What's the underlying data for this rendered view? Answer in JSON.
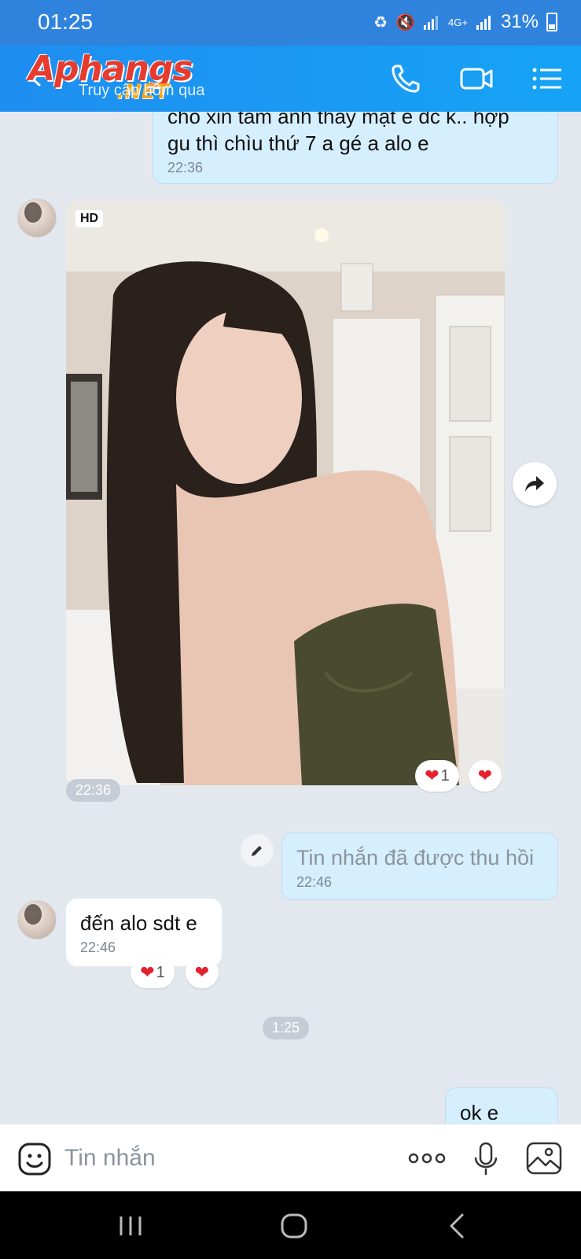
{
  "status_bar": {
    "time": "01:25",
    "network": "4G+",
    "battery": "31%"
  },
  "header": {
    "logo_main": "Aphangs",
    "logo_net": ".NET",
    "subtitle": "Truy cập hôm qua"
  },
  "messages": [
    {
      "direction": "out",
      "text_line1": "cho xin tấm ảnh thấy mặt e dc k.. hợp",
      "text_line2": "gu thì chìu thứ 7 a gé a alo e",
      "time": "22:36"
    },
    {
      "direction": "in",
      "type": "photo",
      "badge": "HD",
      "time": "22:36",
      "reaction_count": "1"
    },
    {
      "direction": "out",
      "text": "Tin nhắn đã được thu hồi",
      "time": "22:46"
    },
    {
      "direction": "in",
      "text": "đến alo sdt e",
      "time": "22:46",
      "reaction_count": "1"
    },
    {
      "direction": "out",
      "text": "ok e"
    }
  ],
  "divider_time": "1:25",
  "input": {
    "placeholder": "Tin nhắn"
  },
  "icons": {
    "back": "back-arrow-icon",
    "call": "phone-icon",
    "video": "video-camera-icon",
    "menu": "list-menu-icon",
    "forward": "share-forward-icon",
    "edit": "pencil-icon",
    "emoji": "emoji-icon",
    "more": "more-dots-icon",
    "mic": "microphone-icon",
    "image": "image-icon",
    "reaction": "heart-icon"
  },
  "colors": {
    "header_blue": "#1e8ef0",
    "outgoing_bubble": "#d5efff",
    "chat_background": "#e3e8ef",
    "heart_red": "#e5202e"
  }
}
